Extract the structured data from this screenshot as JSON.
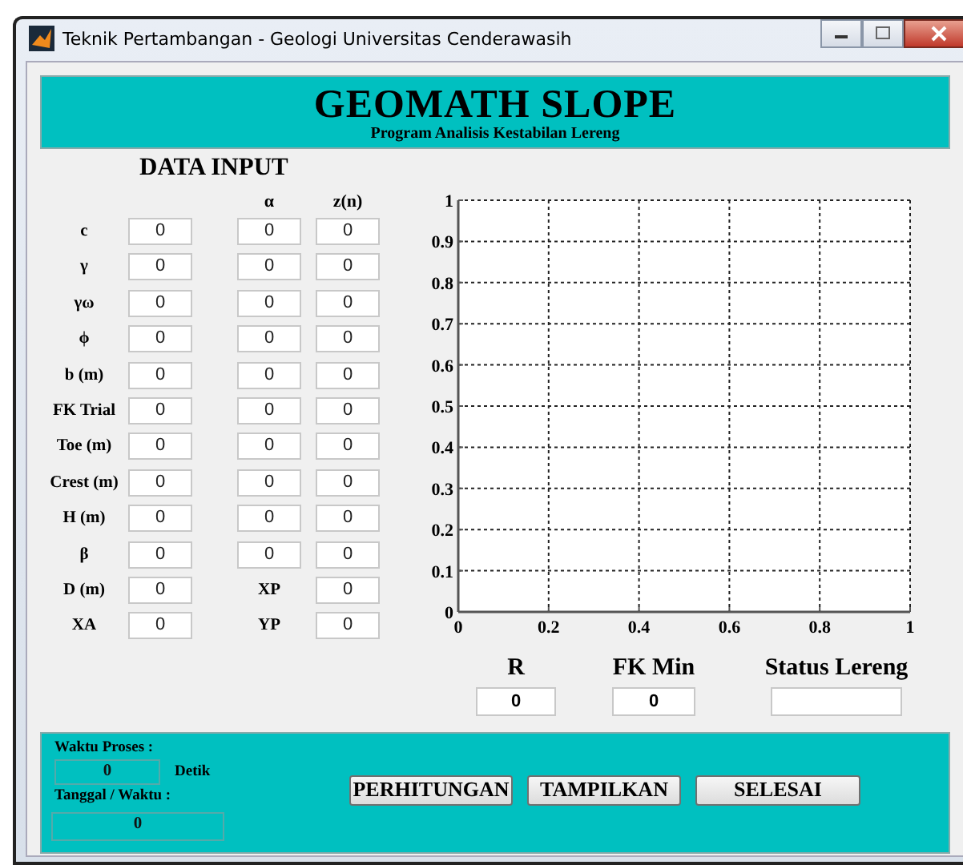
{
  "window": {
    "title": "Teknik Pertambangan - Geologi Universitas Cenderawasih"
  },
  "header": {
    "title": "GEOMATH SLOPE",
    "subtitle": "Program Analisis Kestabilan Lereng"
  },
  "data_input": {
    "title": "DATA INPUT",
    "column_headers": [
      "α",
      "z(n)"
    ],
    "rows": [
      {
        "kind": "angle",
        "label": "c",
        "value": "0",
        "alpha": "0",
        "zn": "0"
      },
      {
        "kind": "angle",
        "label": "γ",
        "value": "0",
        "alpha": "0",
        "zn": "0"
      },
      {
        "kind": "angle",
        "label": "γω",
        "value": "0",
        "alpha": "0",
        "zn": "0"
      },
      {
        "kind": "angle",
        "label": "ϕ",
        "value": "0",
        "alpha": "0",
        "zn": "0"
      },
      {
        "kind": "angle",
        "label": "b  (m)",
        "value": "0",
        "alpha": "0",
        "zn": "0"
      },
      {
        "kind": "angle",
        "label": "FK Trial",
        "value": "0",
        "alpha": "0",
        "zn": "0"
      },
      {
        "kind": "angle",
        "label": "Toe (m)",
        "value": "0",
        "alpha": "0",
        "zn": "0"
      },
      {
        "kind": "angle",
        "label": "Crest (m)",
        "value": "0",
        "alpha": "0",
        "zn": "0"
      },
      {
        "kind": "angle",
        "label": "H (m)",
        "value": "0",
        "alpha": "0",
        "zn": "0"
      },
      {
        "kind": "angle",
        "label": "β",
        "value": "0",
        "alpha": "0",
        "zn": "0"
      },
      {
        "kind": "point",
        "label": "D (m)",
        "value": "0",
        "point_label": "XP",
        "point_value": "0"
      },
      {
        "kind": "point",
        "label": "XA",
        "value": "0",
        "point_label": "YP",
        "point_value": "0"
      }
    ]
  },
  "chart_data": {
    "type": "line",
    "grid": true,
    "xlim": [
      0,
      1
    ],
    "ylim": [
      0,
      1
    ],
    "xticks": [
      0,
      0.2,
      0.4,
      0.6,
      0.8,
      1
    ],
    "yticks": [
      0,
      0.1,
      0.2,
      0.3,
      0.4,
      0.5,
      0.6,
      0.7,
      0.8,
      0.9,
      1
    ]
  },
  "results": [
    {
      "label": "R",
      "value": "0"
    },
    {
      "label": "FK Min",
      "value": "0"
    },
    {
      "label": "Status Lereng"
    }
  ],
  "footer": {
    "process_time_label": "Waktu Proses :",
    "process_time": "0",
    "process_time_unit": "Detik",
    "datetime_label": "Tanggal / Waktu :",
    "datetime": "0",
    "buttons": [
      "PERHITUNGAN",
      "TAMPILKAN",
      "SELESAI"
    ]
  }
}
